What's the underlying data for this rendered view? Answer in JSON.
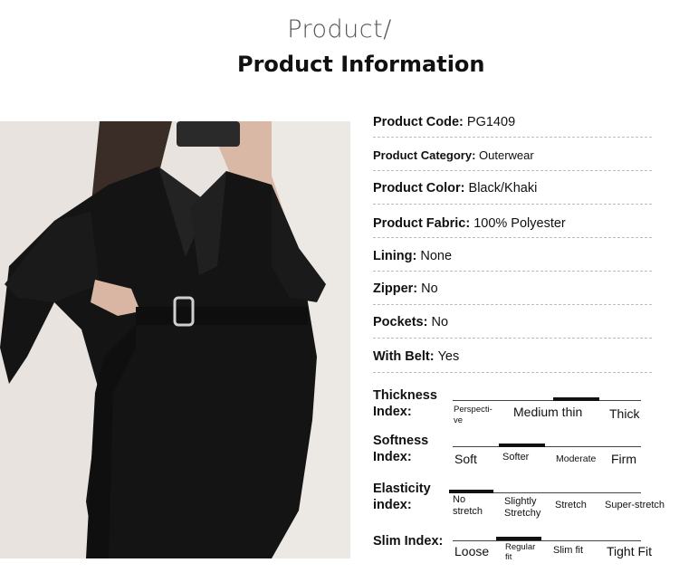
{
  "header": {
    "title_small": "Product/",
    "title_large": "Product Information"
  },
  "photo": {
    "description_icon": "product-photo"
  },
  "info_rows": [
    {
      "label": "Product Code: ",
      "value": "PG1409"
    },
    {
      "label": "Product Category: ",
      "value": "Outerwear"
    },
    {
      "label": "Product Color: ",
      "value": "Black/Khaki"
    },
    {
      "label": "Product Fabric: ",
      "value": "100% Polyester"
    },
    {
      "label": "Lining: ",
      "value": "None"
    },
    {
      "label": "Zipper: ",
      "value": "No"
    },
    {
      "label": "Pockets: ",
      "value": "No"
    },
    {
      "label": "With Belt: ",
      "value": "Yes"
    }
  ],
  "indices": {
    "thickness": {
      "label_line1": "Thickness",
      "label_line2": "Index:",
      "options": [
        "Perspecti-ve",
        "Medium thin",
        "Thick"
      ],
      "selected": "Medium thin"
    },
    "softness": {
      "label_line1": "Softness",
      "label_line2": "Index:",
      "options": [
        "Soft",
        "Softer",
        "Moderate",
        "Firm"
      ],
      "selected": "Softer"
    },
    "elasticity": {
      "label_line1": "Elasticity",
      "label_line2": "index:",
      "options": [
        "No stretch",
        "Slightly Stretchy",
        "Stretch",
        "Super-stretch"
      ],
      "selected": "No stretch"
    },
    "slim": {
      "label_line1": "Slim Index:",
      "options": [
        "Loose",
        "Regular fit",
        "Slim fit",
        "Tight Fit"
      ],
      "selected": "Regular fit"
    }
  },
  "colors": {
    "background": "#ffffff",
    "text": "#111111",
    "separator": "#bdbdbd",
    "marker": "#111111"
  }
}
